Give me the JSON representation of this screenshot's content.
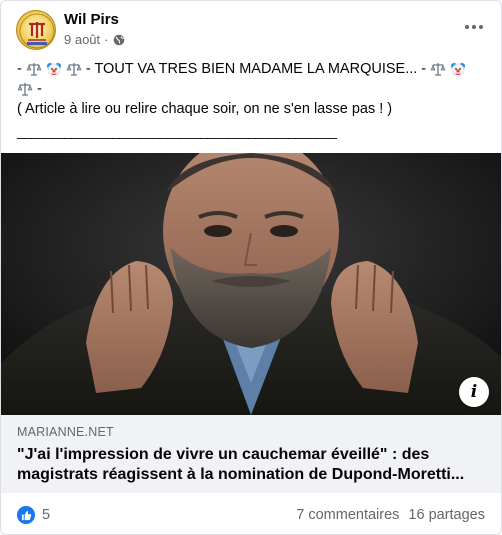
{
  "post": {
    "author": "Wil Pirs",
    "date": "9 août",
    "separator_dot": "·",
    "text": {
      "line1_prefix": "-",
      "line1_mid": "-",
      "line1_main": "- TOUT VA TRES BIEN MADAME LA MARQUISE... -",
      "line2": "-",
      "line3": "( Article à lire ou relire chaque soir, on ne s'en lasse pas ! )",
      "separator": "_______________________________________________"
    },
    "emoji": [
      "scales-emoji",
      "clown-face-emoji"
    ]
  },
  "link_preview": {
    "domain": "MARIANNE.NET",
    "headline": "\"J'ai l'impression de vivre un cauchemar éveillé\" : des magistrats réagissent à la nomination de Dupond-Moretti..."
  },
  "reactions": {
    "like_count": "5",
    "comments": "7 commentaires",
    "shares": "16 partages"
  },
  "colors": {
    "accent": "#1877f2",
    "secondary_text": "#65676b",
    "link_box_bg": "#f0f2f5"
  }
}
